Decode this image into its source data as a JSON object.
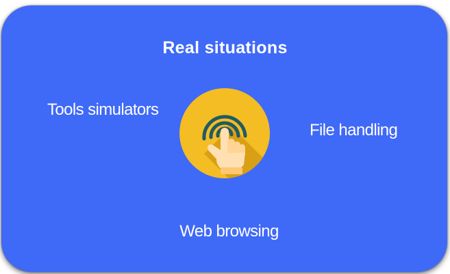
{
  "card": {
    "title": "Real situations",
    "items": {
      "tools": "Tools simulators",
      "file": "File handling",
      "web": "Web browsing"
    },
    "center_icon": "touch-hand-icon",
    "colors": {
      "card_background": "#3f69f7",
      "icon_circle": "#f3bd23",
      "icon_circle_shadow": "#d69c14",
      "ripple": "#215a63",
      "hand": "#ffe0b2"
    }
  }
}
